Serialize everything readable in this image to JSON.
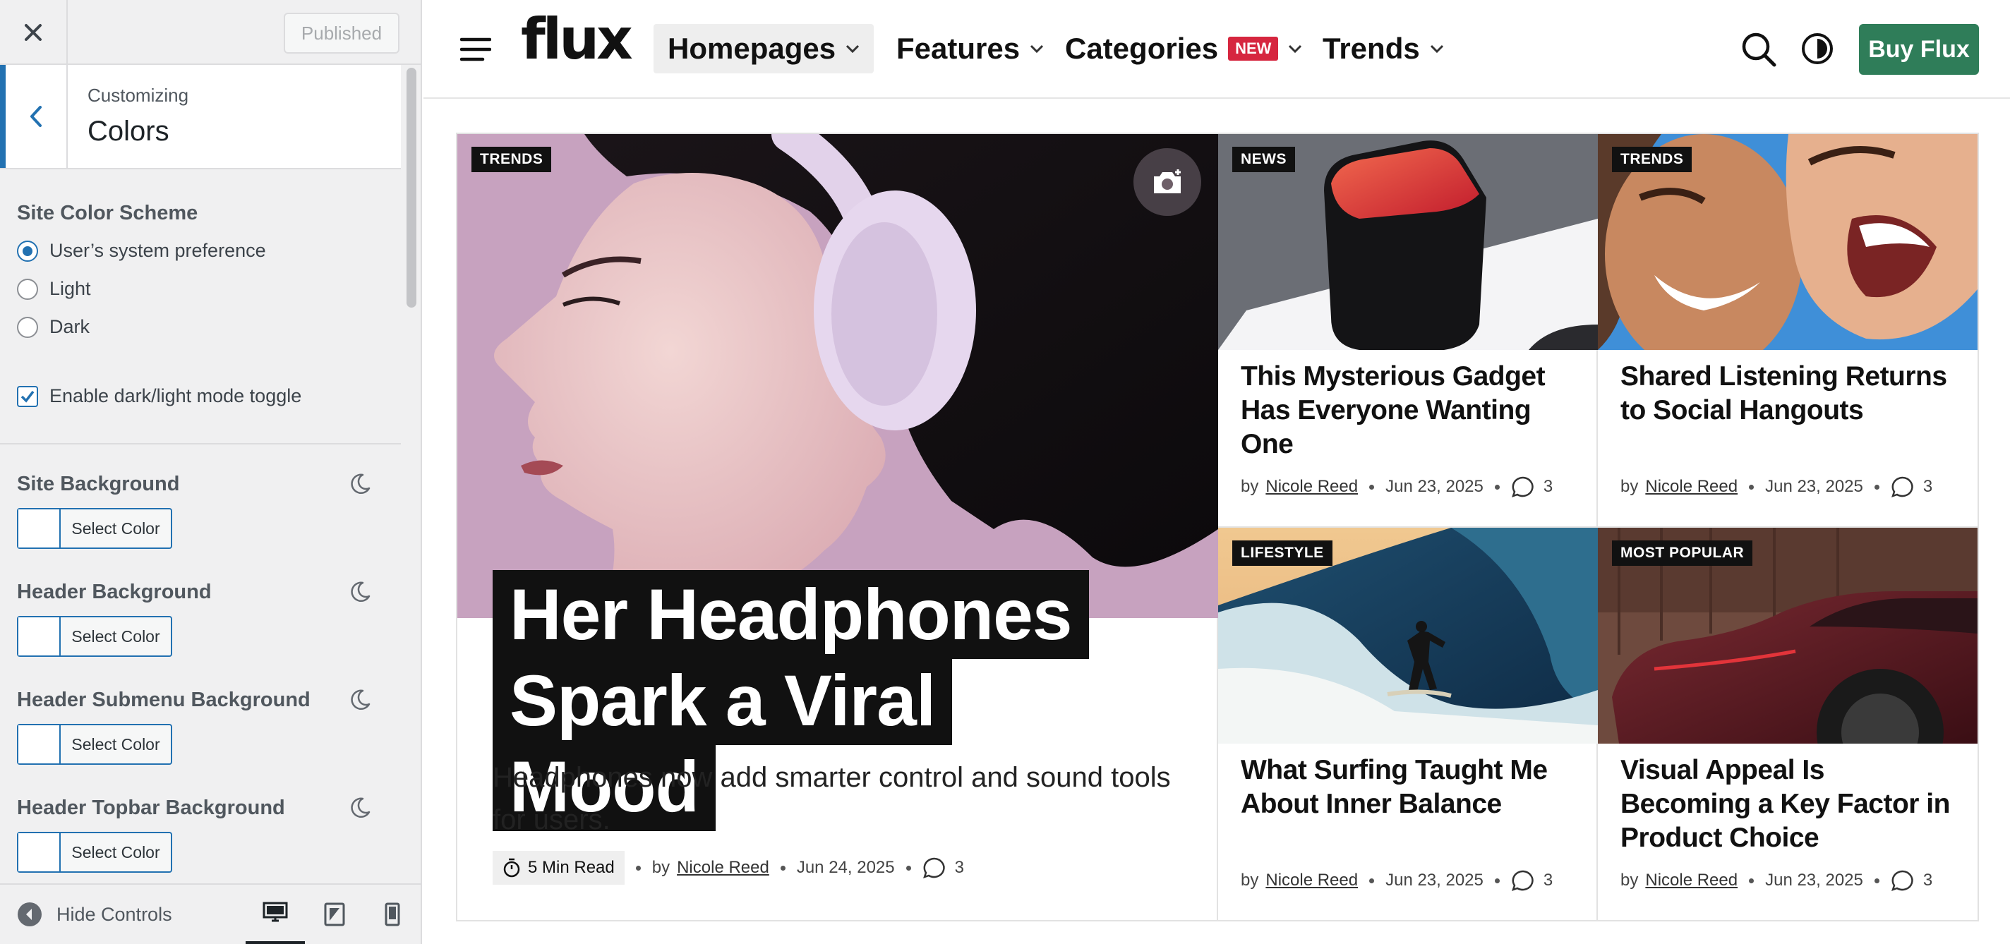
{
  "customizer": {
    "published_label": "Published",
    "customizing_label": "Customizing",
    "section_title": "Colors",
    "scheme": {
      "label": "Site Color Scheme",
      "options": [
        "User’s system preference",
        "Light",
        "Dark"
      ],
      "selected": "User’s system preference"
    },
    "toggle_label": "Enable dark/light mode toggle",
    "color_settings": [
      {
        "label": "Site Background",
        "button": "Select Color"
      },
      {
        "label": "Header Background",
        "button": "Select Color"
      },
      {
        "label": "Header Submenu Background",
        "button": "Select Color"
      },
      {
        "label": "Header Topbar Background",
        "button": "Select Color"
      }
    ],
    "hide_controls_label": "Hide Controls"
  },
  "site": {
    "logo": "flux",
    "nav": [
      {
        "label": "Homepages",
        "active": true
      },
      {
        "label": "Features"
      },
      {
        "label": "Categories",
        "badge": "NEW"
      },
      {
        "label": "Trends"
      }
    ],
    "buy_label": "Buy Flux",
    "hero": {
      "tag": "TRENDS",
      "title_line1": "Her Headphones",
      "title_line2": "Spark a Viral Mood",
      "excerpt": "Headphones now add smarter control and sound tools for users.",
      "read_time": "5 Min Read",
      "by": "by",
      "author": "Nicole Reed",
      "date": "Jun 24, 2025",
      "comments": "3"
    },
    "cards": [
      {
        "tag": "NEWS",
        "title": "This Mysterious Gadget Has Everyone Wanting One",
        "by": "by",
        "author": "Nicole Reed",
        "date": "Jun 23, 2025",
        "comments": "3"
      },
      {
        "tag": "TRENDS",
        "title": "Shared Listening Returns to Social Hangouts",
        "by": "by",
        "author": "Nicole Reed",
        "date": "Jun 23, 2025",
        "comments": "3"
      },
      {
        "tag": "LIFESTYLE",
        "title": "What Surfing Taught Me About Inner Balance",
        "by": "by",
        "author": "Nicole Reed",
        "date": "Jun 23, 2025",
        "comments": "3"
      },
      {
        "tag": "MOST POPULAR",
        "title": "Visual Appeal Is Becoming a Key Factor in Product Choice",
        "by": "by",
        "author": "Nicole Reed",
        "date": "Jun 23, 2025",
        "comments": "3"
      }
    ]
  },
  "colors": {
    "accent": "#2271b1",
    "buy_button": "#2f7d59",
    "new_badge": "#d6263f"
  }
}
